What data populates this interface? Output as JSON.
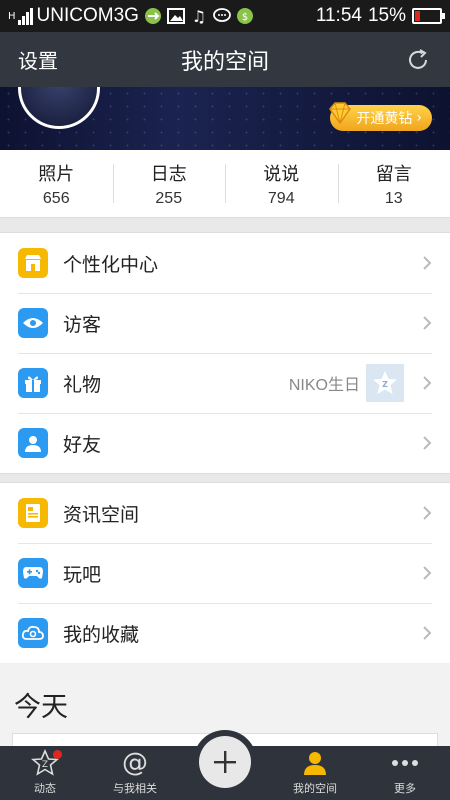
{
  "status_bar": {
    "network": "H",
    "carrier": "UNICOM3G",
    "time": "11:54",
    "battery": "15%"
  },
  "header": {
    "left_label": "设置",
    "title": "我的空间"
  },
  "banner": {
    "vip_label": "开通黄钻"
  },
  "stats": [
    {
      "label": "照片",
      "value": "656"
    },
    {
      "label": "日志",
      "value": "255"
    },
    {
      "label": "说说",
      "value": "794"
    },
    {
      "label": "留言",
      "value": "13"
    }
  ],
  "menu_group_1": [
    {
      "label": "个性化中心",
      "icon": "store-icon",
      "color": "#f6b800"
    },
    {
      "label": "访客",
      "icon": "eye-icon",
      "color": "#2c9af0"
    },
    {
      "label": "礼物",
      "icon": "gift-icon",
      "color": "#2c9af0",
      "extra": "NIKO生日"
    },
    {
      "label": "好友",
      "icon": "friend-icon",
      "color": "#2c9af0"
    }
  ],
  "menu_group_2": [
    {
      "label": "资讯空间",
      "icon": "news-icon",
      "color": "#f6b800"
    },
    {
      "label": "玩吧",
      "icon": "gamepad-icon",
      "color": "#2c9af0"
    },
    {
      "label": "我的收藏",
      "icon": "favorites-icon",
      "color": "#2c9af0"
    }
  ],
  "today": {
    "title": "今天"
  },
  "tabbar": [
    {
      "label": "动态",
      "icon": "star-icon"
    },
    {
      "label": "与我相关",
      "icon": "at-icon"
    },
    {
      "label": "",
      "icon": "plus-icon"
    },
    {
      "label": "我的空间",
      "icon": "profile-icon"
    },
    {
      "label": "更多",
      "icon": "more-icon"
    }
  ],
  "colors": {
    "header_bg": "#333740",
    "tabbar_bg": "#2f333b",
    "accent_blue": "#2c9af0",
    "accent_yellow": "#f6b800",
    "notify_red": "#e0271f"
  }
}
